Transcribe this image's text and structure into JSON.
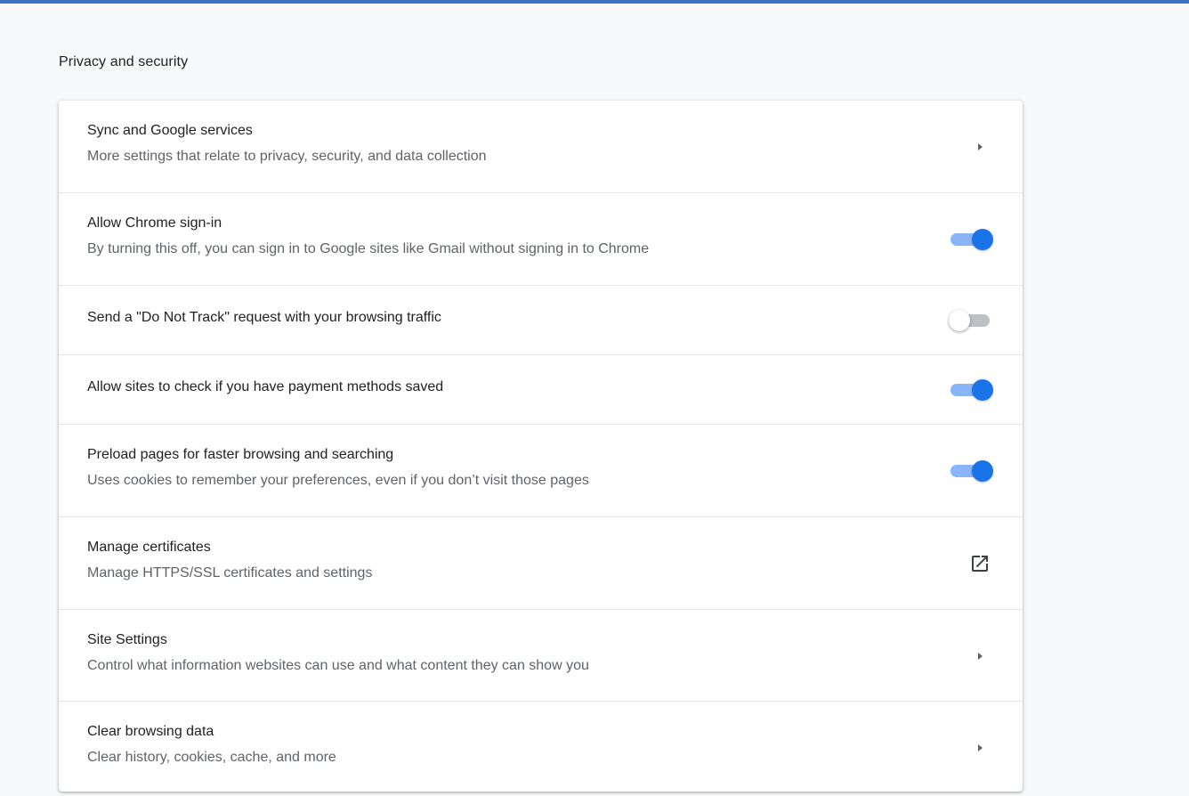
{
  "section": {
    "title": "Privacy and security"
  },
  "rows": [
    {
      "title": "Sync and Google services",
      "subtitle": "More settings that relate to privacy, security, and data collection",
      "control": "arrow"
    },
    {
      "title": "Allow Chrome sign-in",
      "subtitle": "By turning this off, you can sign in to Google sites like Gmail without signing in to Chrome",
      "control": "toggle",
      "toggle_on": true
    },
    {
      "title": "Send a \"Do Not Track\" request with your browsing traffic",
      "control": "toggle",
      "toggle_on": false
    },
    {
      "title": "Allow sites to check if you have payment methods saved",
      "control": "toggle",
      "toggle_on": true
    },
    {
      "title": "Preload pages for faster browsing and searching",
      "subtitle": "Uses cookies to remember your preferences, even if you don’t visit those pages",
      "control": "toggle",
      "toggle_on": true
    },
    {
      "title": "Manage certificates",
      "subtitle": "Manage HTTPS/SSL certificates and settings",
      "control": "external-link"
    },
    {
      "title": "Site Settings",
      "subtitle": "Control what information websites can use and what content they can show you",
      "control": "arrow"
    },
    {
      "title": "Clear browsing data",
      "subtitle": "Clear history, cookies, cache, and more",
      "control": "arrow"
    }
  ],
  "icons": {
    "arrow": "arrow-right-icon",
    "external": "open-in-new-icon"
  },
  "colors": {
    "top_bar": "#3f6fc4",
    "toggle_on_knob": "#1a73e8",
    "toggle_on_track": "#8ab4f8",
    "toggle_off_track": "#bdc1c6"
  }
}
